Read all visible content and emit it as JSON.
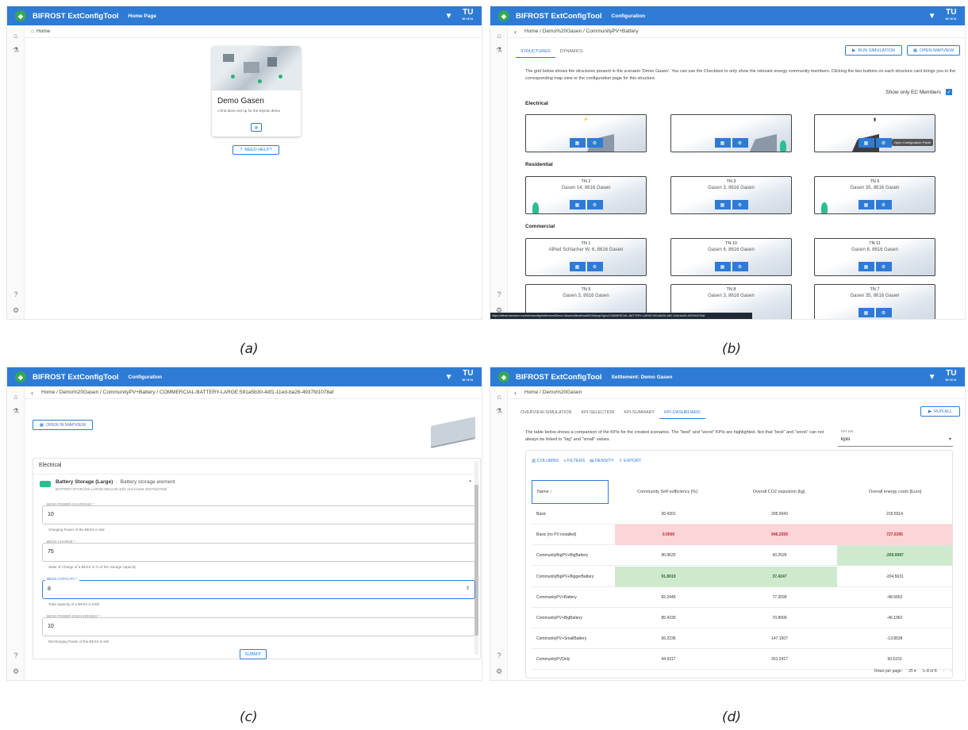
{
  "app_title": "BIFROST ExtConfigTool",
  "tu": "TU",
  "tu_sub": "WIEN",
  "captions": {
    "a": "(a)",
    "b": "(b)",
    "c": "(c)",
    "d": "(d)"
  },
  "a": {
    "page": "Home Page",
    "crumb": "Home",
    "card_title": "Demo Gasen",
    "card_desc": "A first demo set up for the Styrian demo",
    "help": "NEED HELP?"
  },
  "b": {
    "page": "Configuration",
    "crumb": "Home / Demo%20Gasen / CommunityPV+Battery",
    "tabs": [
      "STRUCTURES",
      "DYNAMICS"
    ],
    "run": "RUN SIMULATION",
    "map": "OPEN MAPVIEW",
    "intro": "The grid below shows the structures present in the scenario 'Demo Gasen'. You can use the Checkbox to only show the relevant energy community members. Clicking the two buttons on each structure card brings you to the corresponding map view or the configuration page for this structure.",
    "ec_label": "Show only EC Members",
    "tooltip": "Open Configuration Panel",
    "sections": [
      "Electrical",
      "Residential",
      "Commercial"
    ],
    "residential": [
      {
        "tn": "TN 2",
        "addr": "Gasen 14, 8616 Gasen"
      },
      {
        "tn": "TN 3",
        "addr": "Gasen 3, 8616 Gasen"
      },
      {
        "tn": "TN 6",
        "addr": "Gasen 35, 8616 Gasen"
      }
    ],
    "commercial": [
      {
        "tn": "TN 1",
        "addr": "Alfred Schlacher W. 6, 8616 Gasen"
      },
      {
        "tn": "TN 10",
        "addr": "Gasen 6, 8616 Gasen"
      },
      {
        "tn": "TN 11",
        "addr": "Gasen 8, 8616 Gasen"
      },
      {
        "tn": "TN 5",
        "addr": "Gasen 3, 8616 Gasen"
      },
      {
        "tn": "TN 8",
        "addr": "Gasen 3, 8616 Gasen"
      },
      {
        "tn": "TN 7",
        "addr": "Gasen 35, 8616 Gasen"
      }
    ],
    "status_url": "https://bifrost.sensenu.com/#/extconfig/settlement/Demo Gasen/s/BestSeat/8100b/pqs7/ghc/COMMERCIAL-BATTERY-LARGE:591a5b30-4df1-11ed-ba26-4937fd1078af"
  },
  "c": {
    "page": "Configuration",
    "crumb": "Home / Demo%20Gasen / CommunityPV+Battery / COMMERCIAL-BATTERY-LARGE:591a5b30-4df1-11ed-ba26-4937fd1078af",
    "map": "OPEN IN MAPVIEW",
    "section": "Electrical",
    "el_name": "Battery Storage (Large)",
    "el_desc": "Battery storage element",
    "el_id": "BATTERY-STORAGE-LARGE:591cc30-4df1-11ed-ba26-4937fd1078af",
    "fields": [
      {
        "label": "BESS-POWER-CHARGING *",
        "value": "10",
        "help": "Charging Power of the BESS in kW"
      },
      {
        "label": "BESS-CHARGE *",
        "value": "75",
        "help": "State of Charge of a BESS in % of the storage capacity"
      },
      {
        "label": "BESS-CAPACITY *",
        "value": "8",
        "help": "Total capacity of a BESS in kWh"
      },
      {
        "label": "BESS-POWER-DISCHARGING *",
        "value": "10",
        "help": "Discharging Power of the BESS in kW"
      }
    ],
    "submit": "SUBMIT"
  },
  "d": {
    "page": "Settlement: Demo Gasen",
    "crumb": "Home / Demo%20Gasen",
    "tabs": [
      "OVERVIEW-SIMULATION",
      "KPI-SELECTION",
      "KPI-SUMMARY",
      "KPI-DASHBOARD"
    ],
    "run": "RUN ALL",
    "intro": "The table below shows a comparison of the KPIs for the created scenarios. The \"best\" and \"worst\" KPIs are highlighted. Not that \"best\" and \"worst\" can not always be linked to \"big\" and \"small\" values.",
    "kpi_label": "KPI Set",
    "kpi_value": "kpis",
    "toolbar": [
      "COLUMNS",
      "FILTERS",
      "DENSITY",
      "EXPORT"
    ],
    "cols": [
      "Name ↑",
      "Community Self-sufficiency [%]",
      "Overall CO2 expulsion [kg]",
      "Overall energy costs [Euro]"
    ],
    "rows": [
      [
        "Basic",
        "36.4301",
        "295.9043",
        "215.5914"
      ],
      [
        "Basic (no PV installed)",
        "0.0000",
        "946.2559",
        "727.0295"
      ],
      [
        "CommunityBigPV+BigBattery",
        "90.9625",
        "43.2026",
        "-209.0087"
      ],
      [
        "CommunityBigPV+BiggerBattery",
        "91.8919",
        "37.4247",
        "-204.5631"
      ],
      [
        "CommunityPV+Battery",
        "82.2445",
        "77.3099",
        "-48.5662"
      ],
      [
        "CommunityPV+BigBattery",
        "85.4339",
        "70.8909",
        "-46.1962"
      ],
      [
        "CommunityPV+SmallBattery",
        "66.2236",
        "147.1507",
        "-13.8538"
      ],
      [
        "CommunityPVOnly",
        "44.9317",
        "261.2417",
        "50.6153"
      ]
    ],
    "highlight": {
      "1": {
        "1": "bad",
        "2": "bad",
        "3": "bad"
      },
      "2": {
        "3": "good"
      },
      "3": {
        "1": "good",
        "2": "good"
      }
    },
    "rows_per_page_label": "Rows per page:",
    "rows_per_page": "25",
    "range": "1–8 of 8"
  }
}
